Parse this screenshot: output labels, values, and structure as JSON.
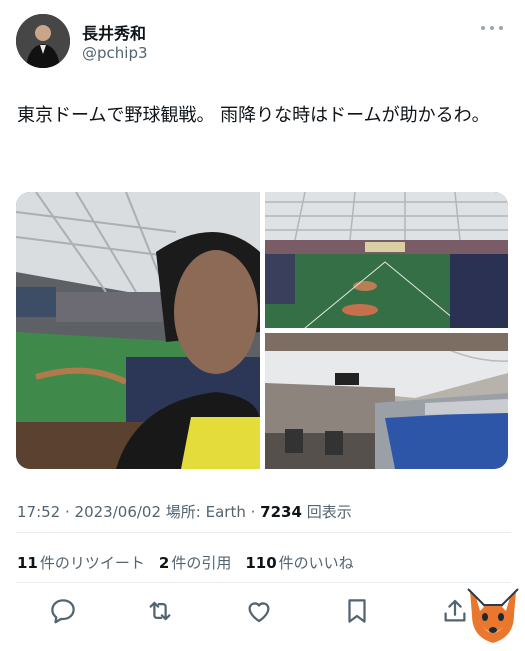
{
  "header": {
    "display_name": "長井秀和",
    "handle": "@pchip3",
    "more_icon": "more-horizontal-icon"
  },
  "tweet": {
    "text": "東京ドームで野球観戦。 雨降りな時はドームが助かるわ。"
  },
  "photos": [
    {
      "name": "selfie-in-stadium-photo"
    },
    {
      "name": "stadium-field-photo"
    },
    {
      "name": "stadium-seats-photo"
    }
  ],
  "meta": {
    "time": "17:52",
    "date": "2023/06/02",
    "location_label": "場所: Earth",
    "views_count": "7234",
    "views_label": "回表示"
  },
  "stats": {
    "retweets_count": "11",
    "retweets_label": "件のリツイート",
    "quotes_count": "2",
    "quotes_label": "件の引用",
    "likes_count": "110",
    "likes_label": "件のいいね"
  },
  "actions": [
    "reply-icon",
    "retweet-icon",
    "like-icon",
    "bookmark-icon",
    "share-icon"
  ],
  "colors": {
    "text": "#0f1419",
    "secondary": "#536471",
    "divider": "#e6ecf0",
    "icon": "#536471"
  }
}
